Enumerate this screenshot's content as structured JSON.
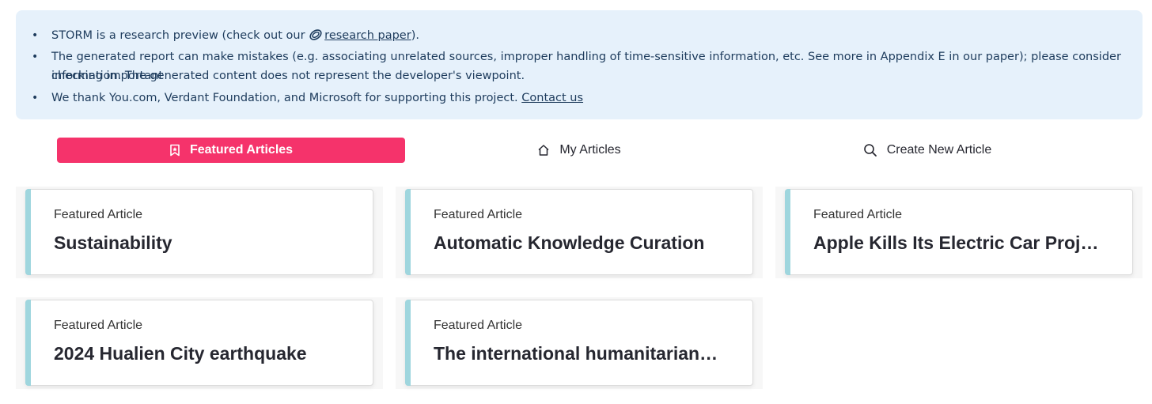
{
  "notice": {
    "line1_prefix": "STORM is a research preview (check out our ",
    "line1_link": "research paper",
    "line1_suffix": ").",
    "line2a": "The generated report can make mistakes (e.g. associating unrelated sources, improper handling of time-sensitive information, etc. See more in Appendix E in our paper); please consider checking important",
    "line2b": "information. The generated content does not represent the developer's viewpoint.",
    "line3_prefix": "We thank You.com, Verdant Foundation, and Microsoft for supporting this project. ",
    "line3_link": "Contact us",
    "bullet": "•",
    "icon": "paperclip-icon"
  },
  "tabs": [
    {
      "label": "Featured Articles",
      "icon": "bookmark-icon",
      "active": true
    },
    {
      "label": "My Articles",
      "icon": "home-icon",
      "active": false
    },
    {
      "label": "Create New Article",
      "icon": "search-icon",
      "active": false
    }
  ],
  "cards": [
    {
      "kicker": "Featured Article",
      "title": "Sustainability"
    },
    {
      "kicker": "Featured Article",
      "title": "Automatic Knowledge Curation"
    },
    {
      "kicker": "Featured Article",
      "title": "Apple Kills Its Electric Car Proj…"
    },
    {
      "kicker": "Featured Article",
      "title": "2024 Hualien City earthquake"
    },
    {
      "kicker": "Featured Article",
      "title": "The international humanitarian…"
    }
  ],
  "colors": {
    "notice_bg": "#e6f1fb",
    "accent": "#f5336b",
    "card_stripe": "#9fd6de"
  }
}
